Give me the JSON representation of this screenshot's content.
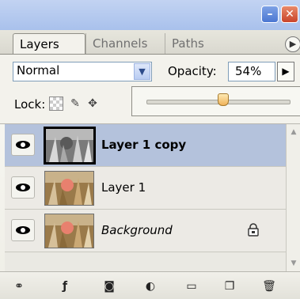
{
  "tabs": [
    {
      "label": "Layers",
      "active": true
    },
    {
      "label": "Channels",
      "active": false
    },
    {
      "label": "Paths",
      "active": false
    }
  ],
  "blend": {
    "mode": "Normal",
    "opacity_label": "Opacity:",
    "opacity_value": "54%",
    "opacity_fraction": 0.54
  },
  "lock": {
    "label": "Lock:"
  },
  "layers": [
    {
      "name": "Layer 1 copy",
      "selected": true
    },
    {
      "name": "Layer 1",
      "selected": false
    },
    {
      "name": "Background",
      "selected": false,
      "locked": true
    }
  ],
  "colors": {
    "selected_row": "#b4c2dc",
    "title_bar": "#a9c1ec",
    "close_button": "#c9442a"
  },
  "icons": {
    "window": [
      "minimize-icon",
      "close-icon"
    ],
    "lock_options": [
      "lock-transparent-pixels-icon",
      "lock-image-pixels-icon",
      "lock-position-icon"
    ],
    "bottom_toolbar": [
      "link-layers-icon",
      "layer-style-icon",
      "layer-mask-icon",
      "adjustment-layer-icon",
      "new-group-icon",
      "new-layer-icon",
      "delete-layer-icon"
    ]
  }
}
